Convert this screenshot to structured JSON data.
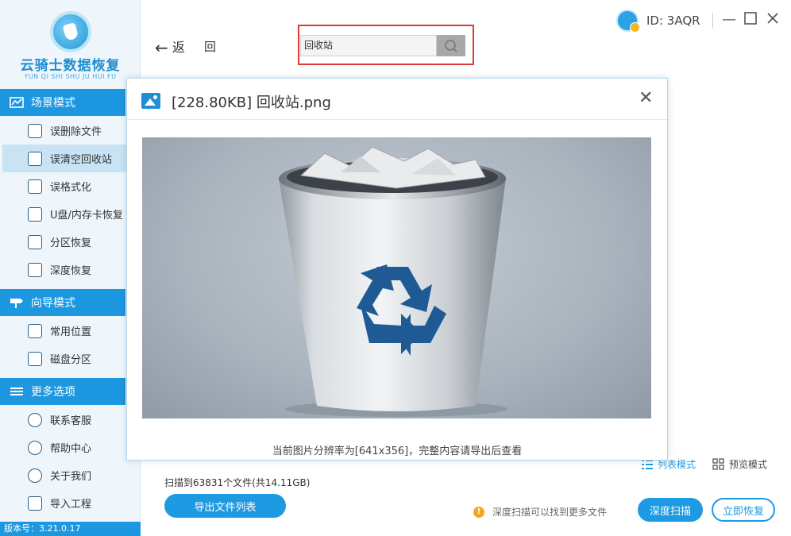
{
  "app": {
    "logo_title": "云骑士数据恢复",
    "logo_subtitle": "YUN QI SHI SHU JU HUI FU",
    "version": "版本号：3.21.0.17"
  },
  "sidebar": {
    "sections": [
      {
        "label": "场景模式",
        "items": [
          {
            "label": "误删除文件",
            "icon": "deleted-file-icon"
          },
          {
            "label": "误清空回收站",
            "icon": "recycle-bin-icon",
            "active": true
          },
          {
            "label": "误格式化",
            "icon": "format-disk-icon"
          },
          {
            "label": "U盘/内存卡恢复",
            "icon": "usb-card-icon"
          },
          {
            "label": "分区恢复",
            "icon": "partition-icon"
          },
          {
            "label": "深度恢复",
            "icon": "deep-recover-icon"
          }
        ]
      },
      {
        "label": "向导模式",
        "items": [
          {
            "label": "常用位置",
            "icon": "windows-icon"
          },
          {
            "label": "磁盘分区",
            "icon": "disk-partition-icon"
          }
        ]
      },
      {
        "label": "更多选项",
        "items": [
          {
            "label": "联系客服",
            "icon": "phone-icon"
          },
          {
            "label": "帮助中心",
            "icon": "help-icon"
          },
          {
            "label": "关于我们",
            "icon": "info-icon"
          },
          {
            "label": "导入工程",
            "icon": "import-icon"
          }
        ]
      }
    ]
  },
  "topbar": {
    "back_label": "返",
    "back_label2": "回",
    "search_value": "回收站",
    "user_id": "ID: 3AQR"
  },
  "dialog": {
    "title": "[228.80KB] 回收站.png",
    "caption": "当前图片分辨率为[641x356]，完整内容请导出后查看"
  },
  "footer": {
    "scan_info": "扫描到63831个文件(共14.11GB)",
    "export_label": "导出文件列表",
    "list_mode": "列表模式",
    "preview_mode": "预览模式",
    "tip": "深度扫描可以找到更多文件",
    "deep_scan_label": "深度扫描",
    "recover_label": "立即恢复"
  },
  "colors": {
    "accent": "#1d97e0",
    "active_item_bg": "#c7e3f4",
    "search_outline": "#e03b3b"
  }
}
